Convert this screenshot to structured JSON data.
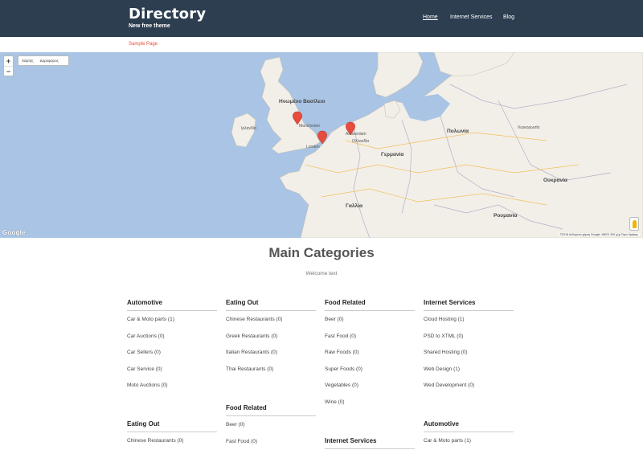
{
  "header": {
    "title": "Directory",
    "tagline": "New free theme",
    "nav": [
      {
        "label": "Home",
        "active": true
      },
      {
        "label": "Internet Services",
        "active": false
      },
      {
        "label": "Blog",
        "active": false
      }
    ]
  },
  "subnav": {
    "label": "Sample Page"
  },
  "map": {
    "zoom_in": "+",
    "zoom_out": "−",
    "type_options": [
      "Χάρτης",
      "Δορυφόρος"
    ],
    "google_logo": "Google",
    "attribution": "©2016 Δεδομένα χάρτη Google, INEGI   200 χλμ   Όροι Χρήσης",
    "labels": {
      "uk": "Ηνωμένο Βασίλειο",
      "ireland": "Ιρλανδία",
      "manchester": "Manchester",
      "london": "London",
      "amsterdam": "Amsterdam",
      "netherlands": "Ολλανδία",
      "germany": "Γερμανία",
      "poland": "Πολωνία",
      "belarus": "Λευκορωσία",
      "ukraine": "Ουκρανία",
      "france": "Γαλλία",
      "romania": "Ρουμανία"
    },
    "colors": {
      "sea": "#a9c4e4",
      "land": "#f2efe9",
      "marker": "#e74c3c"
    }
  },
  "main": {
    "title": "Main Categories",
    "subtitle": "Welcome text",
    "columns": [
      {
        "blocks": [
          {
            "heading": "Automotive",
            "items": [
              "Car & Moto parts (1)",
              "Car Auctions (0)",
              "Car Sellers (0)",
              "Car Service (0)",
              "Moto Auctions (0)"
            ]
          },
          {
            "heading": "Eating Out",
            "items": [
              "Chinese Restaurants (0)"
            ]
          }
        ]
      },
      {
        "blocks": [
          {
            "heading": "Eating Out",
            "items": [
              "Chinese Restaurants (0)",
              "Greek Restaurants (0)",
              "Italian Restaurants (0)",
              "Thai Restaurants (0)"
            ]
          },
          {
            "heading": "Food Related",
            "items": [
              "Beer (0)",
              "Fast Food (0)"
            ]
          }
        ]
      },
      {
        "blocks": [
          {
            "heading": "Food Related",
            "items": [
              "Beer (0)",
              "Fast Food (0)",
              "Raw Foods (0)",
              "Super Foods (0)",
              "Vegetables (0)",
              "Wine (0)"
            ]
          },
          {
            "heading": "Internet Services",
            "items": []
          }
        ]
      },
      {
        "blocks": [
          {
            "heading": "Internet Services",
            "items": [
              "Cloud Hosting (1)",
              "PSD to XTML (0)",
              "Shared Hosting (0)",
              "Web Design (1)",
              "Wed Development (0)"
            ]
          },
          {
            "heading": "Automotive",
            "items": [
              "Car & Moto parts (1)"
            ]
          }
        ]
      }
    ]
  }
}
